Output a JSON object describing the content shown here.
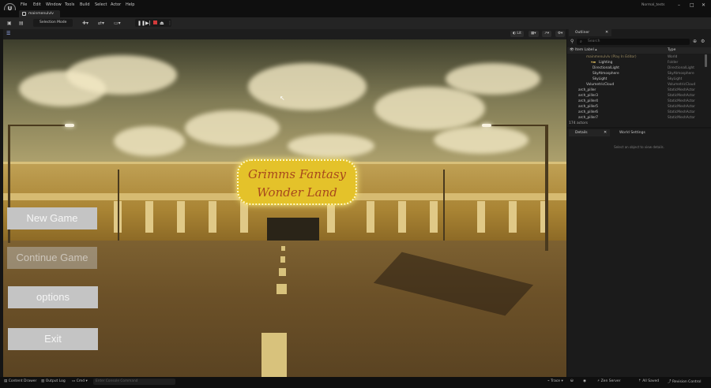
{
  "app": {
    "logo": "U",
    "menu": [
      "File",
      "Edit",
      "Window",
      "Tools",
      "Build",
      "Select",
      "Actor",
      "Help"
    ],
    "project_name": "Normal_tests",
    "window_controls": {
      "minimize": "–",
      "maximize": "□",
      "close": "✕"
    }
  },
  "tab": {
    "label": "mainmenulvlv"
  },
  "toolbar": {
    "mode_label": "Selection Mode"
  },
  "viewport": {
    "view_mode": "Lit",
    "sign_line1": "Grimms Fantasy",
    "sign_line2": "Wonder Land",
    "menu_buttons": {
      "new_game": "New Game",
      "continue_game": "Continue Game",
      "options": "options",
      "exit": "Exit"
    }
  },
  "outliner": {
    "tab_label": "Outliner",
    "search_placeholder": "Search",
    "col_label": "Item Label ▴",
    "col_type": "Type",
    "rows": [
      {
        "label": "mainmenulvlv (Play In Editor)",
        "type": "World"
      },
      {
        "label": "Lighting",
        "type": "Folder"
      },
      {
        "label": "DirectionalLight",
        "type": "DirectionalLight"
      },
      {
        "label": "SkyAtmosphere",
        "type": "SkyAtmosphere"
      },
      {
        "label": "SkyLight",
        "type": "SkyLight"
      },
      {
        "label": "VolumetricCloud",
        "type": "VolumetricCloud"
      },
      {
        "label": "arch_piller",
        "type": "StaticMeshActor"
      },
      {
        "label": "arch_piller3",
        "type": "StaticMeshActor"
      },
      {
        "label": "arch_piller4",
        "type": "StaticMeshActor"
      },
      {
        "label": "arch_piller5",
        "type": "StaticMeshActor"
      },
      {
        "label": "arch_piller6",
        "type": "StaticMeshActor"
      },
      {
        "label": "arch_piller7",
        "type": "StaticMeshActor"
      }
    ],
    "actor_count": "174 actors"
  },
  "details": {
    "tab_label": "Details",
    "world_settings_label": "World Settings",
    "empty_message": "Select an object to view details."
  },
  "statusbar": {
    "content_drawer": "Content Drawer",
    "output_log": "Output Log",
    "cmd": "Cmd",
    "cmd_placeholder": "Enter Console Command",
    "trace": "Trace",
    "zen_server": "Zen Server",
    "all_saved": "All Saved",
    "revision_control": "Revision Control"
  },
  "colors": {
    "accent": "#c4c4c4",
    "panel": "#1b1b1b",
    "sign": "#e4c22a"
  }
}
